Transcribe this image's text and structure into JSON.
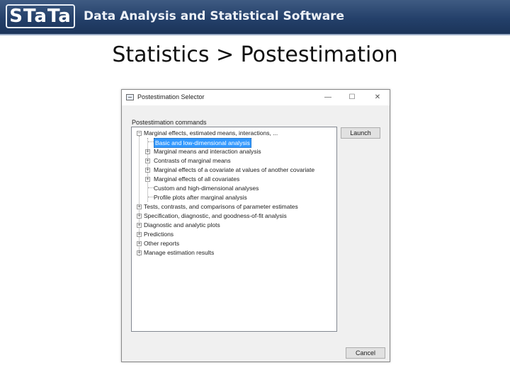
{
  "banner": {
    "logo_text": "STaTa",
    "title": "Data Analysis and Statistical Software"
  },
  "slide": {
    "title": "Statistics > Postestimation"
  },
  "dialog": {
    "title": "Postestimation Selector",
    "minimize_glyph": "—",
    "maximize_glyph": "☐",
    "close_glyph": "✕",
    "group_label": "Postestimation commands",
    "launch_label": "Launch",
    "cancel_label": "Cancel",
    "tree": [
      {
        "label": "Marginal effects, estimated means, interactions, ...",
        "expander": "−"
      },
      {
        "label": "Basic and low-dimensional analysis",
        "selected": true
      },
      {
        "label": "Marginal means and interaction analysis",
        "expander": "+"
      },
      {
        "label": "Contrasts of marginal means",
        "expander": "+"
      },
      {
        "label": "Marginal effects of a covariate at values of another covariate",
        "expander": "+"
      },
      {
        "label": "Marginal effects of all covariates",
        "expander": "+"
      },
      {
        "label": "Custom and high-dimensional analyses"
      },
      {
        "label": "Profile plots after marginal analysis"
      },
      {
        "label": "Tests, contrasts, and comparisons of parameter estimates",
        "expander": "+"
      },
      {
        "label": "Specification, diagnostic, and goodness-of-fit analysis",
        "expander": "+"
      },
      {
        "label": "Diagnostic and analytic plots",
        "expander": "+"
      },
      {
        "label": "Predictions",
        "expander": "+"
      },
      {
        "label": "Other reports",
        "expander": "+"
      },
      {
        "label": "Manage estimation results",
        "expander": "+"
      }
    ]
  }
}
